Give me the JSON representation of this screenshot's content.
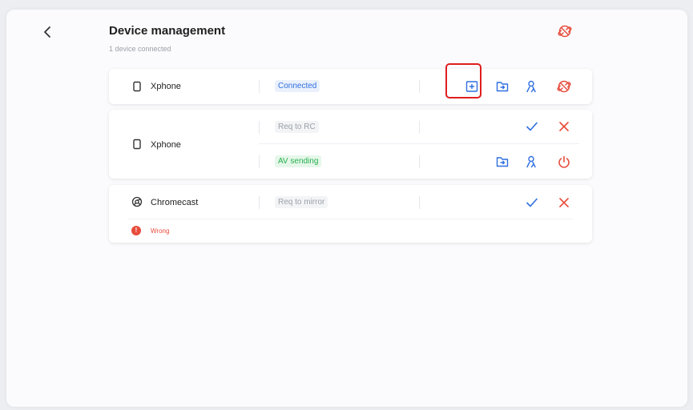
{
  "header": {
    "title": "Device management",
    "subtitle": "1 device connected",
    "icons": [
      "chevron-left-icon",
      "unlink-icon"
    ]
  },
  "devices": [
    {
      "name": "Xphone",
      "icon": "phone-icon",
      "status": "Connected"
    },
    {
      "name": "Xphone",
      "icon": "phone-icon",
      "status_top": "Req to RC",
      "status_bottom": "AV sending"
    },
    {
      "name": "Chromecast",
      "icon": "chromecast-icon",
      "status": "Req to mirror",
      "error_mark": "!",
      "error": "Wrong"
    }
  ],
  "colors": {
    "accent": "#2f6fe0",
    "danger": "#e74c3c",
    "success": "#27b04f",
    "highlight": "#e01e1e"
  }
}
